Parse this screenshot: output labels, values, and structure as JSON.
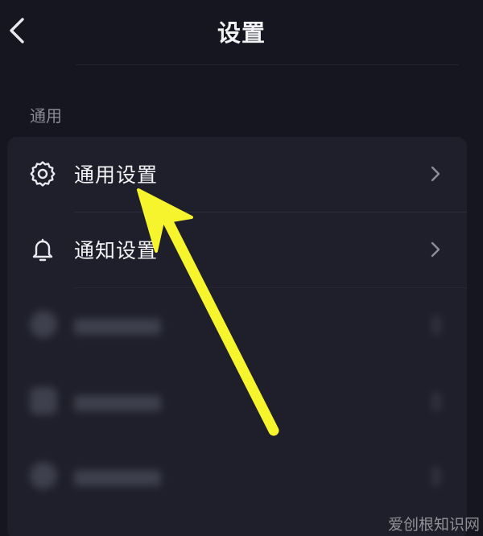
{
  "header": {
    "title": "设置",
    "back_icon": "chevron-left-icon"
  },
  "section": {
    "label": "通用"
  },
  "items": [
    {
      "label": "通用设置",
      "icon": "gear-icon",
      "chevron": "chevron-right-icon"
    },
    {
      "label": "通知设置",
      "icon": "bell-icon",
      "chevron": "chevron-right-icon"
    }
  ],
  "annotation": {
    "arrow_color": "#f6f52d"
  },
  "watermark": "爱创根知识网",
  "colors": {
    "background": "#161621",
    "card": "#1f1f2b",
    "text": "#f4f4f7",
    "section_text": "#8a8a97"
  }
}
